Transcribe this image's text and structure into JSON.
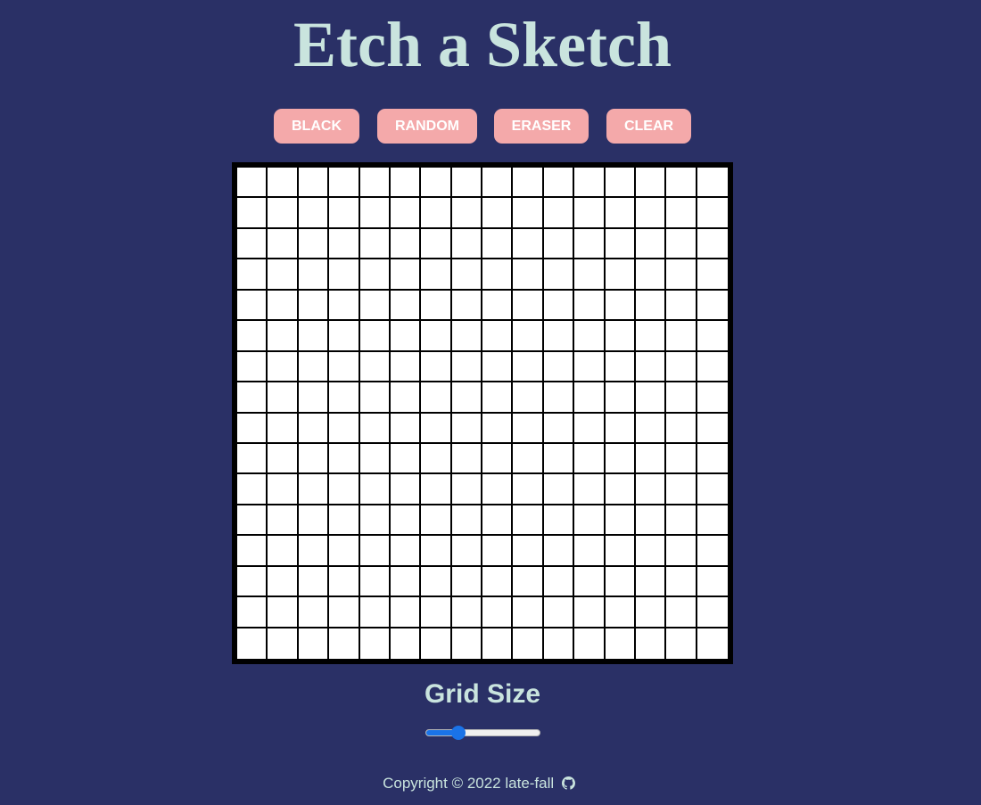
{
  "header": {
    "title": "Etch a Sketch"
  },
  "toolbar": {
    "black_label": "BLACK",
    "random_label": "RANDOM",
    "eraser_label": "ERASER",
    "clear_label": "CLEAR"
  },
  "grid": {
    "rows": 16,
    "columns": 16
  },
  "grid_size": {
    "label": "Grid Size",
    "slider_fraction": 0.26
  },
  "footer": {
    "text": "Copyright © 2022 late-fall",
    "icon": "github-icon"
  },
  "colors": {
    "background": "#2a3066",
    "accent_text": "#c9e4de",
    "button": "#f4a9aa",
    "slider": "#1a73e8"
  }
}
